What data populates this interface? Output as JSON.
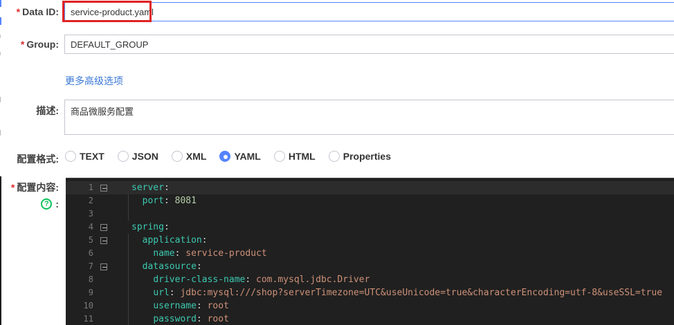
{
  "form": {
    "required_mark": "*",
    "data_id": {
      "label": "Data ID:",
      "value": "service-product.yaml"
    },
    "group": {
      "label": "Group:",
      "value": "DEFAULT_GROUP"
    },
    "advanced_link": "更多高级选项",
    "description": {
      "label": "描述:",
      "value": "商品微服务配置"
    },
    "format": {
      "label": "配置格式:",
      "options": [
        "TEXT",
        "JSON",
        "XML",
        "YAML",
        "HTML",
        "Properties"
      ],
      "selected": "YAML"
    },
    "content": {
      "label": "配置内容:",
      "help_icon_glyph": "?",
      "help_colon": ":"
    }
  },
  "colors": {
    "focus_border": "#5584ff",
    "input_border": "#c4c6cf",
    "link": "#3a77d6",
    "annotation_red": "#e02222",
    "help_green": "#0bc25c",
    "editor_bg": "#202020",
    "editor_active_line": "#2c2c2c",
    "editor_key": "#3dc9b0",
    "editor_string": "#ce9178",
    "editor_number": "#b5cea8",
    "editor_punct": "#d4d4d4",
    "editor_line_number": "#7a7a7a"
  },
  "editor": {
    "language": "yaml",
    "active_line": 1,
    "lines": [
      {
        "n": "1",
        "fold": true,
        "guide": false,
        "parts": [
          [
            "key",
            "server"
          ],
          [
            "p",
            ":"
          ]
        ]
      },
      {
        "n": "2",
        "fold": false,
        "guide": true,
        "parts": [
          [
            "p",
            "  "
          ],
          [
            "key",
            "port"
          ],
          [
            "p",
            ": "
          ],
          [
            "num",
            "8081"
          ]
        ]
      },
      {
        "n": "3",
        "fold": false,
        "guide": true,
        "parts": []
      },
      {
        "n": "4",
        "fold": true,
        "guide": false,
        "parts": [
          [
            "key",
            "spring"
          ],
          [
            "p",
            ":"
          ]
        ]
      },
      {
        "n": "5",
        "fold": true,
        "guide": true,
        "parts": [
          [
            "p",
            "  "
          ],
          [
            "key",
            "application"
          ],
          [
            "p",
            ":"
          ]
        ]
      },
      {
        "n": "6",
        "fold": false,
        "guide": true,
        "parts": [
          [
            "p",
            "    "
          ],
          [
            "key",
            "name"
          ],
          [
            "p",
            ": "
          ],
          [
            "str",
            "service-product"
          ]
        ]
      },
      {
        "n": "7",
        "fold": true,
        "guide": true,
        "parts": [
          [
            "p",
            "  "
          ],
          [
            "key",
            "datasource"
          ],
          [
            "p",
            ":"
          ]
        ]
      },
      {
        "n": "8",
        "fold": false,
        "guide": true,
        "parts": [
          [
            "p",
            "    "
          ],
          [
            "key",
            "driver-class-name"
          ],
          [
            "p",
            ": "
          ],
          [
            "str",
            "com.mysql.jdbc.Driver"
          ]
        ]
      },
      {
        "n": "9",
        "fold": false,
        "guide": true,
        "parts": [
          [
            "p",
            "    "
          ],
          [
            "key",
            "url"
          ],
          [
            "p",
            ": "
          ],
          [
            "str",
            "jdbc:mysql:///shop?serverTimezone=UTC&useUnicode=true&characterEncoding=utf-8&useSSL=true"
          ]
        ]
      },
      {
        "n": "10",
        "fold": false,
        "guide": true,
        "parts": [
          [
            "p",
            "    "
          ],
          [
            "key",
            "username"
          ],
          [
            "p",
            ": "
          ],
          [
            "str",
            "root"
          ]
        ]
      },
      {
        "n": "11",
        "fold": false,
        "guide": true,
        "parts": [
          [
            "p",
            "    "
          ],
          [
            "key",
            "password"
          ],
          [
            "p",
            ": "
          ],
          [
            "str",
            "root"
          ]
        ]
      }
    ]
  }
}
